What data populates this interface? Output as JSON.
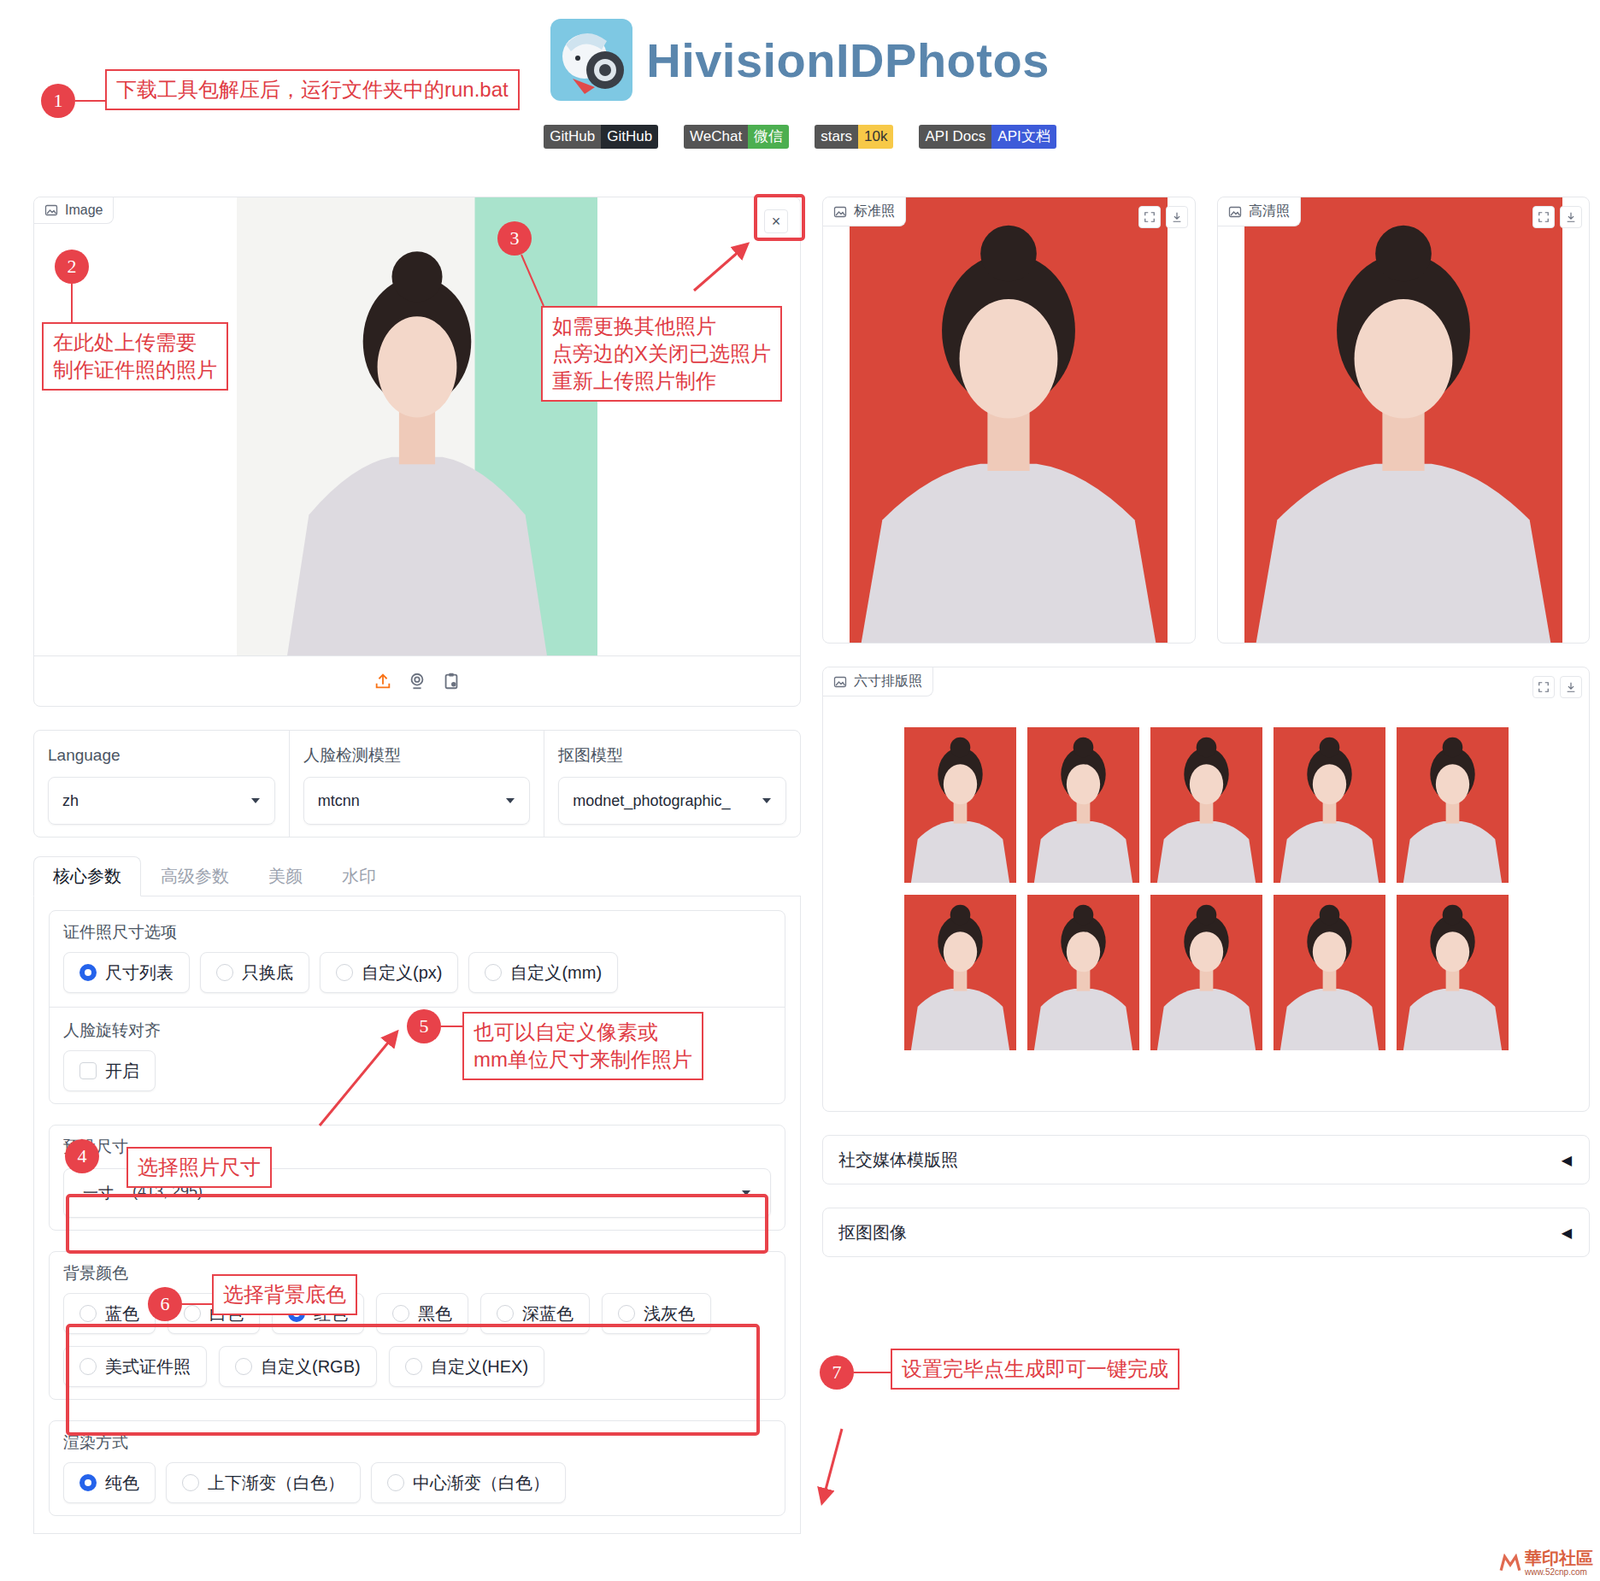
{
  "header": {
    "title": "HivisionIDPhotos",
    "badges": [
      {
        "label": "GitHub",
        "value": "GitHub",
        "color": "#24292f"
      },
      {
        "label": "WeChat",
        "value": "微信",
        "color": "#4caf50"
      },
      {
        "label": "stars",
        "value": "10k",
        "color": "#f7c948"
      },
      {
        "label": "API Docs",
        "value": "API文档",
        "color": "#3d5bd9"
      }
    ]
  },
  "image_input": {
    "label": "Image",
    "close": "×"
  },
  "models": [
    {
      "label": "Language",
      "value": "zh"
    },
    {
      "label": "人脸检测模型",
      "value": "mtcnn"
    },
    {
      "label": "抠图模型",
      "value": "modnet_photographic_"
    }
  ],
  "tabs": [
    {
      "label": "核心参数",
      "selected": true
    },
    {
      "label": "高级参数",
      "selected": false
    },
    {
      "label": "美颜",
      "selected": false
    },
    {
      "label": "水印",
      "selected": false
    }
  ],
  "size_options": {
    "label": "证件照尺寸选项",
    "options": [
      {
        "label": "尺寸列表",
        "selected": true
      },
      {
        "label": "只换底",
        "selected": false
      },
      {
        "label": "自定义(px)",
        "selected": false
      },
      {
        "label": "自定义(mm)",
        "selected": false
      }
    ]
  },
  "face_align": {
    "label": "人脸旋转对齐",
    "option": "开启",
    "checked": false
  },
  "preset_size": {
    "label": "预设尺寸",
    "value": "一寸",
    "dims": "(413, 295)"
  },
  "background": {
    "label": "背景颜色",
    "options": [
      {
        "label": "蓝色",
        "selected": false
      },
      {
        "label": "白色",
        "selected": false
      },
      {
        "label": "红色",
        "selected": true
      },
      {
        "label": "黑色",
        "selected": false
      },
      {
        "label": "深蓝色",
        "selected": false
      },
      {
        "label": "浅灰色",
        "selected": false
      },
      {
        "label": "美式证件照",
        "selected": false
      },
      {
        "label": "自定义(RGB)",
        "selected": false
      },
      {
        "label": "自定义(HEX)",
        "selected": false
      }
    ]
  },
  "render": {
    "label": "渲染方式",
    "options": [
      {
        "label": "纯色",
        "selected": true
      },
      {
        "label": "上下渐变（白色）",
        "selected": false
      },
      {
        "label": "中心渐变（白色）",
        "selected": false
      }
    ]
  },
  "outputs": [
    {
      "label": "标准照"
    },
    {
      "label": "高清照"
    }
  ],
  "layout": {
    "label": "六寸排版照",
    "photo_count": 10
  },
  "accordions": [
    {
      "label": "社交媒体模版照",
      "icon": "◀",
      "expanded": false
    },
    {
      "label": "抠图图像",
      "icon": "◀",
      "expanded": false
    }
  ],
  "annotations": [
    {
      "number": "1",
      "lines": [
        "下载工具包解压后，运行文件夹中的run.bat"
      ]
    },
    {
      "number": "2",
      "lines": [
        "在此处上传需要",
        "制作证件照的照片"
      ]
    },
    {
      "number": "3",
      "lines": [
        "如需更换其他照片",
        "点旁边的X关闭已选照片",
        "重新上传照片制作"
      ]
    },
    {
      "number": "4",
      "lines": [
        "选择照片尺寸"
      ]
    },
    {
      "number": "5",
      "lines": [
        "也可以自定义像素或",
        "mm单位尺寸来制作照片"
      ]
    },
    {
      "number": "6",
      "lines": [
        "选择背景底色"
      ]
    },
    {
      "number": "7",
      "lines": [
        "设置完毕点生成即可一键完成"
      ]
    }
  ],
  "watermark": {
    "text": "華印社區",
    "url": "www.52cnp.com"
  }
}
